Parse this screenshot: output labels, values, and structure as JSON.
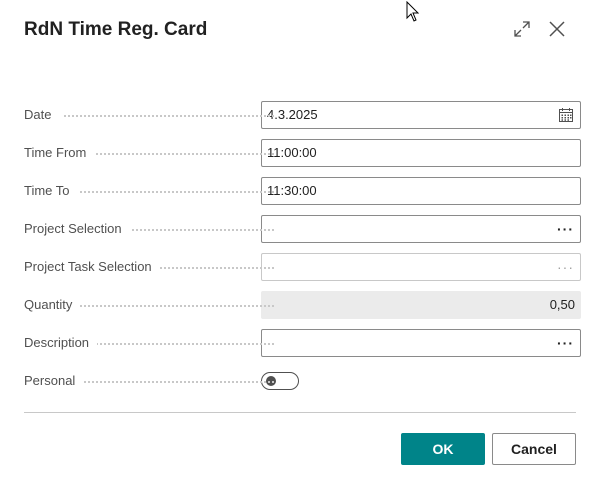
{
  "dialog": {
    "title": "RdN Time Reg. Card"
  },
  "icons": {
    "expand": "expand-icon",
    "close": "close-icon",
    "calendar": "calendar-icon",
    "ellipsis": "ellipsis-icon",
    "cursor": "mouse-cursor"
  },
  "fields": {
    "date": {
      "label": "Date",
      "value": "4.3.2025"
    },
    "time_from": {
      "label": "Time From",
      "value": "11:00:00"
    },
    "time_to": {
      "label": "Time To",
      "value": "11:30:00"
    },
    "project_selection": {
      "label": "Project Selection",
      "value": "",
      "assist": "···"
    },
    "project_task_selection": {
      "label": "Project Task Selection",
      "value": "",
      "assist": "···"
    },
    "quantity": {
      "label": "Quantity",
      "value": "0,50"
    },
    "description": {
      "label": "Description",
      "value": "",
      "assist": "···"
    },
    "personal": {
      "label": "Personal",
      "checked": false
    }
  },
  "buttons": {
    "ok": "OK",
    "cancel": "Cancel"
  },
  "colors": {
    "accent": "#008489",
    "border": "#8a8a8a",
    "readonly_bg": "#ebebeb"
  }
}
